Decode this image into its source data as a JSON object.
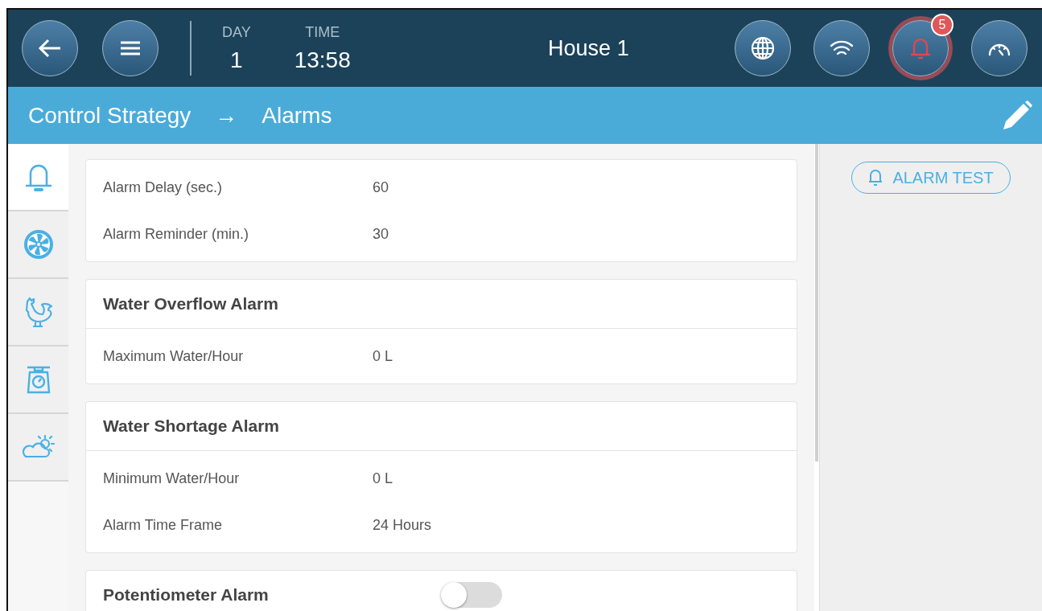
{
  "header": {
    "left_buttons": [
      {
        "kind": "back"
      },
      {
        "kind": "menu"
      }
    ],
    "day": {
      "label": "DAY",
      "value": "1"
    },
    "time": {
      "label": "TIME",
      "value": "13:58"
    },
    "title": "House 1",
    "right_buttons": [
      {
        "kind": "globe",
        "alert": false
      },
      {
        "kind": "wifi",
        "alert": false
      },
      {
        "kind": "bell",
        "alert": true,
        "badge": "5"
      },
      {
        "kind": "gauge",
        "alert": false
      }
    ]
  },
  "breadcrumb": {
    "parent": "Control Strategy",
    "separator": "→",
    "current": "Alarms"
  },
  "sidebar": {
    "tabs": [
      {
        "kind": "bell",
        "selected": true
      },
      {
        "kind": "fan",
        "selected": false
      },
      {
        "kind": "rooster",
        "selected": false
      },
      {
        "kind": "scale",
        "selected": false
      },
      {
        "kind": "weather",
        "selected": false
      }
    ]
  },
  "sections": [
    {
      "rows": [
        {
          "label": "Alarm Delay (sec.)",
          "value": "60"
        },
        {
          "label": "Alarm Reminder (min.)",
          "value": "30"
        }
      ]
    },
    {
      "title": "Water Overflow Alarm",
      "rows": [
        {
          "label": "Maximum Water/Hour",
          "value": "0 L"
        }
      ]
    },
    {
      "title": "Water Shortage Alarm",
      "rows": [
        {
          "label": "Minimum Water/Hour",
          "value": "0 L"
        },
        {
          "label": "Alarm Time Frame",
          "value": "24 Hours"
        }
      ]
    },
    {
      "title": "Potentiometer Alarm",
      "toggle": {
        "on": false
      }
    }
  ],
  "alarm_test_button": {
    "label": "ALARM TEST"
  }
}
